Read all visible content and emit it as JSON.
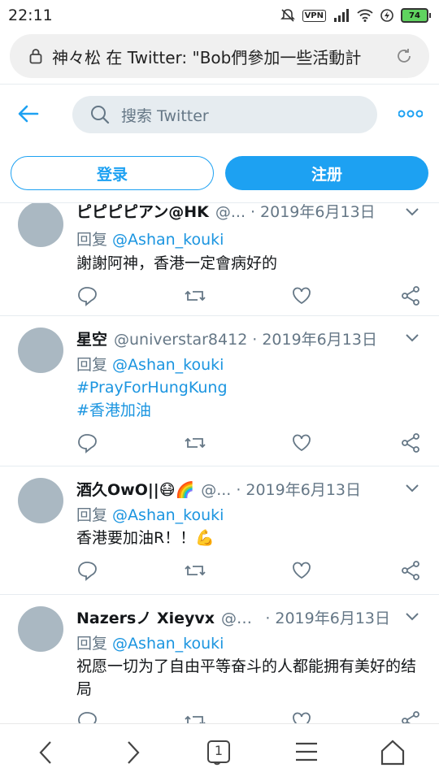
{
  "status": {
    "time": "22:11",
    "vpn": "VPN",
    "battery": "74"
  },
  "browser": {
    "url_text": "神々松 在 Twitter: \"Bob們參加一些活動計"
  },
  "header": {
    "search_placeholder": "搜索 Twitter"
  },
  "auth": {
    "login_label": "登录",
    "signup_label": "注册"
  },
  "tweets": [
    {
      "name": "ピピピピアン@HK",
      "handle": "@...",
      "date": "2019年6月13日",
      "reply_prefix": "回复 ",
      "reply_to": "@Ashan_kouki",
      "text": "謝謝阿神，香港一定會病好的"
    },
    {
      "name": "星空",
      "handle": "@universtar8412",
      "date": "2019年6月13日",
      "reply_prefix": "回复 ",
      "reply_to": "@Ashan_kouki",
      "tag1": "#PrayForHungKung",
      "tag2": "#香港加油"
    },
    {
      "name": "酒久OwO||😷🌈",
      "handle": "@...",
      "date": "2019年6月13日",
      "reply_prefix": "回复 ",
      "reply_to": "@Ashan_kouki",
      "text": "香港要加油R！！💪"
    },
    {
      "name": "Nazersノ Xieyvx",
      "handle": "@Xi...",
      "date": "2019年6月13日",
      "reply_prefix": "回复 ",
      "reply_to": "@Ashan_kouki",
      "text": "祝愿一切为了自由平等奋斗的人都能拥有美好的结局"
    }
  ],
  "nav": {
    "tab_count": "1"
  },
  "colors": {
    "accent": "#1da1f2",
    "link": "#1b95e0",
    "muted": "#657786",
    "avatar": "#aab8c2"
  },
  "icons": [
    "back-arrow-icon",
    "search-icon",
    "more-icon",
    "chevron-down-icon",
    "reply-icon",
    "retweet-icon",
    "like-icon",
    "share-icon",
    "reload-icon",
    "lock-icon"
  ]
}
